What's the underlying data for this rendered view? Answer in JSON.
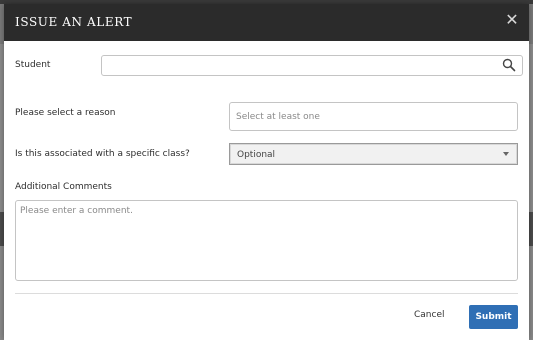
{
  "modal": {
    "title": "ISSUE AN ALERT",
    "close_glyph": "✕"
  },
  "form": {
    "student_label": "Student",
    "student_value": "",
    "student_placeholder": "",
    "reason_label": "Please select a reason",
    "reason_placeholder": "Select at least one",
    "class_label": "Is this associated with a specific class?",
    "class_selected": "Optional",
    "comments_label": "Additional Comments",
    "comments_placeholder": "Please enter a comment."
  },
  "actions": {
    "cancel_label": "Cancel",
    "submit_label": "Submit"
  },
  "colors": {
    "header_bg": "#2b2b2b",
    "primary": "#2f6fb5"
  }
}
